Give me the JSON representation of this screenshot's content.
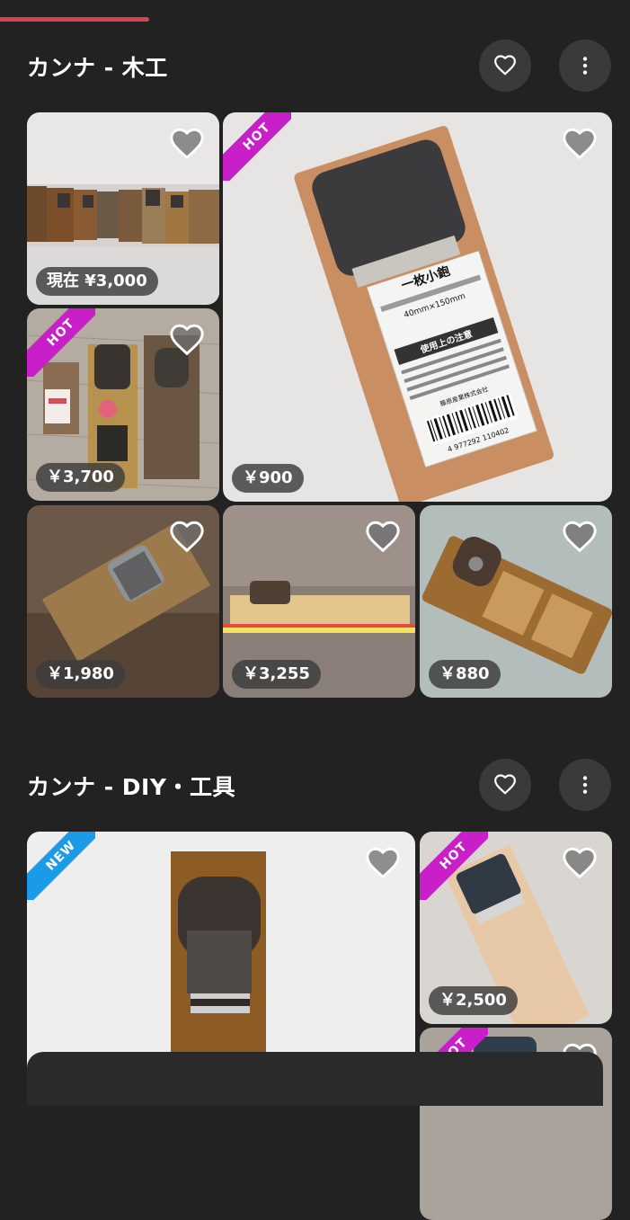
{
  "sections": [
    {
      "title": "カンナ - 木工",
      "items": [
        {
          "price": "現在 ¥3,000",
          "badge": ""
        },
        {
          "price": "￥900",
          "badge": "HOT"
        },
        {
          "price": "￥3,700",
          "badge": "HOT"
        },
        {
          "price": "￥1,980",
          "badge": ""
        },
        {
          "price": "￥3,255",
          "badge": ""
        },
        {
          "price": "￥880",
          "badge": ""
        }
      ]
    },
    {
      "title": "カンナ - DIY・工具",
      "items": [
        {
          "price": "",
          "badge": "NEW"
        },
        {
          "price": "￥2,500",
          "badge": "HOT"
        },
        {
          "price": "",
          "badge": "HOT"
        }
      ]
    }
  ],
  "photo_labels": {
    "sticker_title": "一枚小鉋",
    "sticker_size": "40mm×150mm",
    "sticker_note": "使用上の注意",
    "sticker_maker": "藤原産業株式会社",
    "barcode": "4 977292 110402"
  },
  "colors": {
    "accent": "#d8434f",
    "hot": "#c81fc9",
    "new": "#1a9be8"
  },
  "icons": {
    "favorite": "heart-outline-icon",
    "more": "more-vertical-icon",
    "item_like": "heart-filled-icon"
  }
}
